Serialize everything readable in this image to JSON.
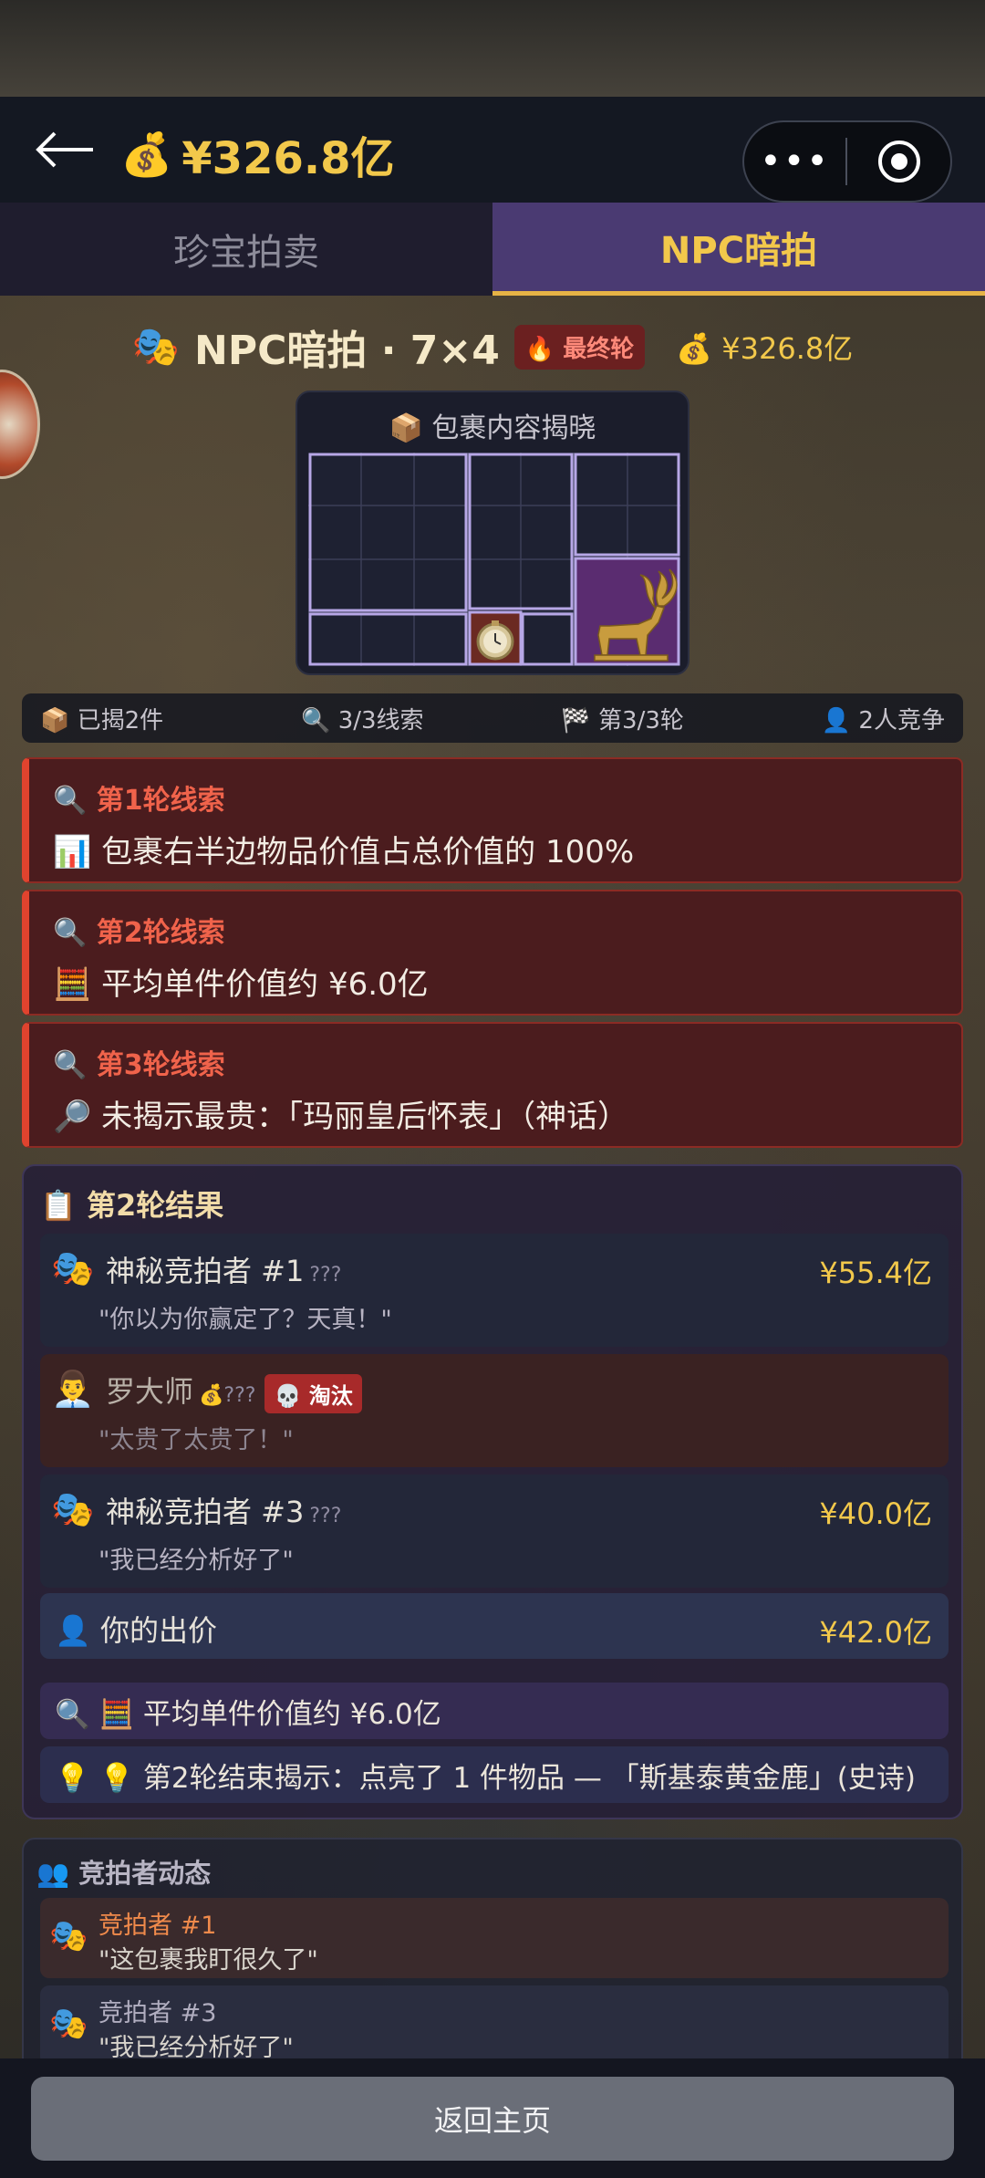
{
  "header": {
    "money_icon": "money-bag-icon",
    "money": "¥326.8亿"
  },
  "tabs": [
    {
      "label": "珍宝拍卖",
      "active": false
    },
    {
      "label": "NPC暗拍",
      "active": true
    }
  ],
  "game": {
    "title": "NPC暗拍 · 7×4",
    "round_badge": "🔥 最终轮",
    "money": "💰 ¥326.8亿",
    "reveal_label": "📦 包裹内容揭晓",
    "items_visible": [
      "pocket-watch",
      "golden-deer"
    ]
  },
  "stats": {
    "revealed": "📦 已揭2件",
    "clues": "🔍 3/3线索",
    "round": "🏁 第3/3轮",
    "competitors": "👤 2人竞争"
  },
  "clues": [
    {
      "head": "🔍 第1轮线索",
      "body": "📊 包裹右半边物品价值占总价值的 100%"
    },
    {
      "head": "🔍 第2轮线索",
      "body": "🧮 平均单件价值约 ¥6.0亿"
    },
    {
      "head": "🔍 第3轮线索",
      "body": "🔎 未揭示最贵：「玛丽皇后怀表」（神话）"
    }
  ],
  "result": {
    "title": "📋 第2轮结果",
    "bidders": [
      {
        "face": "🎭",
        "name": "神秘竞拍者 #1",
        "tag": "???",
        "price": "¥55.4亿",
        "quote": "\"你以为你赢定了？天真！\""
      },
      {
        "face": "👨‍💼",
        "name": "罗大师",
        "tag": "💰???",
        "badge": "💀 淘汰",
        "quote": "\"太贵了太贵了！\""
      },
      {
        "face": "🎭",
        "name": "神秘竞拍者 #3",
        "tag": "???",
        "price": "¥40.0亿",
        "quote": "\"我已经分析好了\""
      }
    ],
    "your_bid_label": "👤 你的出价",
    "your_bid": "¥42.0亿",
    "hint1": "🔍 🧮 平均单件价值约 ¥6.0亿",
    "hint2": "💡 💡 第2轮结束揭示：点亮了 1 件物品 — 「斯基泰黄金鹿」(史诗)"
  },
  "activity": {
    "title": "👥 竞拍者动态",
    "items": [
      {
        "face": "🎭",
        "who": "竞拍者 #1",
        "said": "\"这包裹我盯很久了\""
      },
      {
        "face": "🎭",
        "who": "竞拍者 #3",
        "said": "\"我已经分析好了\""
      }
    ]
  },
  "footer": {
    "home_label": "返回主页"
  }
}
